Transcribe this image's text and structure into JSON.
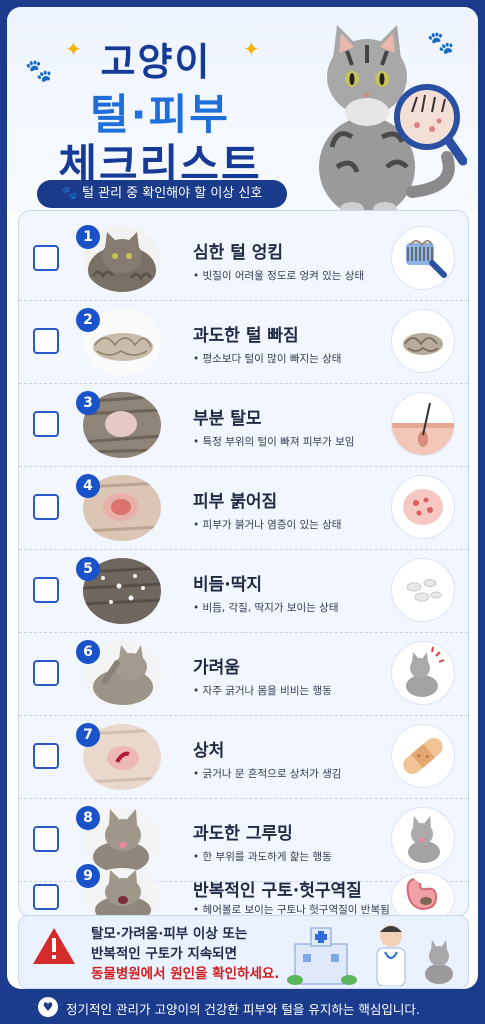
{
  "header": {
    "title_line1": "고양이",
    "title_line2": "털·피부",
    "title_line3": "체크리스트",
    "subtitle": "털 관리 중 확인해야 할 이상 신호"
  },
  "items": [
    {
      "num": "1",
      "title": "심한 털 엉킴",
      "desc": "• 빗질이 어려울 정도로 엉켜 있는 상태",
      "icon": "brush-icon"
    },
    {
      "num": "2",
      "title": "과도한 털 빠짐",
      "desc": "• 평소보다 털이 많이 빠지는 상태",
      "icon": "hair-clump-icon"
    },
    {
      "num": "3",
      "title": "부분 탈모",
      "desc": "• 특정 부위의 털이 빠져 피부가 보임",
      "icon": "skin-follicle-icon"
    },
    {
      "num": "4",
      "title": "피부 붉어짐",
      "desc": "• 피부가 붉거나 염증이 있는 상태",
      "icon": "redness-icon"
    },
    {
      "num": "5",
      "title": "비듬·딱지",
      "desc": "• 비듬, 각질, 딱지가 보이는 상태",
      "icon": "flakes-icon"
    },
    {
      "num": "6",
      "title": "가려움",
      "desc": "• 자주 긁거나 몸을 비비는 행동",
      "icon": "scratching-cat-icon"
    },
    {
      "num": "7",
      "title": "상처",
      "desc": "• 긁거나 문 흔적으로 상처가 생김",
      "icon": "bandage-icon"
    },
    {
      "num": "8",
      "title": "과도한 그루밍",
      "desc": "• 한 부위를 과도하게 핥는 행동",
      "icon": "licking-cat-icon"
    },
    {
      "num": "9",
      "title": "반복적인 구토·헛구역질",
      "desc": "• 헤어볼로 보이는 구토나 헛구역질이 반복됨",
      "icon": "stomach-hairball-icon"
    }
  ],
  "warning": {
    "line1": "탈모·가려움·피부 이상 또는",
    "line2": "반복적인 구토가 지속되면",
    "line3": "동물병원에서 원인을 확인하세요."
  },
  "footer": {
    "text": "정기적인 관리가 고양이의 건강한 피부와 털을 유지하는 핵심입니다."
  },
  "colors": {
    "navy": "#1b3b8c",
    "blue": "#1e6fd9",
    "alert_red": "#d0201f"
  }
}
